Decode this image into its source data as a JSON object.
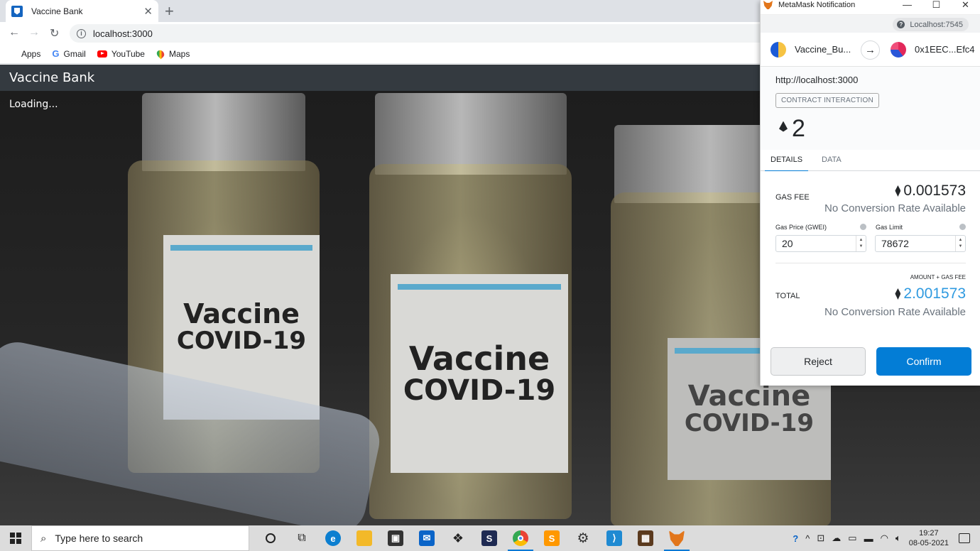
{
  "browser": {
    "tab_title": "Vaccine Bank",
    "url": "localhost:3000",
    "bookmarks": [
      {
        "label": "Apps",
        "icon": "apps-grid-icon"
      },
      {
        "label": "Gmail",
        "icon": "google-icon"
      },
      {
        "label": "YouTube",
        "icon": "youtube-icon"
      },
      {
        "label": "Maps",
        "icon": "maps-icon"
      }
    ]
  },
  "page": {
    "brand": "Vaccine Bank",
    "status": "Loading...",
    "vials": [
      {
        "line1": "Vaccine",
        "line2": "COVID-19"
      },
      {
        "line1": "Vaccine",
        "line2": "COVID-19"
      },
      {
        "line1": "Vaccine",
        "line2": "COVID-19"
      }
    ]
  },
  "metamask": {
    "window_title": "MetaMask Notification",
    "network": "Localhost:7545",
    "from_account": "Vaccine_Bu...",
    "to_account": "0x1EEC...Efc4",
    "origin": "http://localhost:3000",
    "badge": "CONTRACT INTERACTION",
    "amount": "2",
    "tabs": [
      "DETAILS",
      "DATA"
    ],
    "gas_fee_label": "GAS FEE",
    "gas_fee": "0.001573",
    "no_conversion": "No Conversion Rate Available",
    "gas_price_label": "Gas Price (GWEI)",
    "gas_price": "20",
    "gas_limit_label": "Gas Limit",
    "gas_limit": "78672",
    "amount_gas_label": "AMOUNT + GAS FEE",
    "total_label": "TOTAL",
    "total": "2.001573",
    "reject_label": "Reject",
    "confirm_label": "Confirm",
    "accent_color": "#037dd6"
  },
  "taskbar": {
    "search_placeholder": "Type here to search",
    "time": "19:27",
    "date": "08-05-2021"
  }
}
